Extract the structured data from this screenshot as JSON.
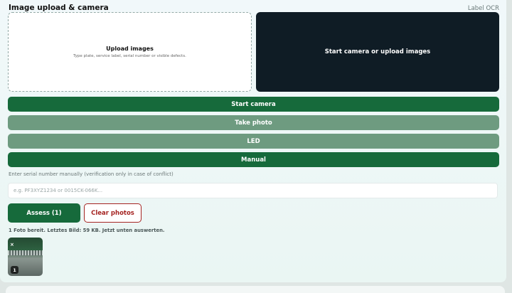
{
  "section": {
    "title": "Image upload & camera",
    "tag": "Label OCR"
  },
  "upload": {
    "title": "Upload images",
    "description": "Type plate, service label, serial number or visible defects."
  },
  "camera": {
    "placeholder": "Start camera or upload images"
  },
  "buttons": {
    "start_camera": "Start camera",
    "take_photo": "Take photo",
    "led": "LED",
    "manual": "Manual",
    "assess": "Assess (1)",
    "clear_photos": "Clear photos"
  },
  "manual_entry": {
    "label": "Enter serial number manually (verification only in case of conflict)",
    "placeholder": "e.g. PF3XYZ1234 or 0015CK-066K...",
    "value": ""
  },
  "status": {
    "text": "1 Foto bereit. Letztes Bild: 59 KB. Jetzt unten auswerten."
  },
  "thumbnails": [
    {
      "remove": "×",
      "index": "1"
    }
  ],
  "colors": {
    "primary": "#166a3b",
    "primary_disabled": "#6e9b80",
    "danger": "#a52422",
    "camera_bg": "#0f1c25"
  }
}
